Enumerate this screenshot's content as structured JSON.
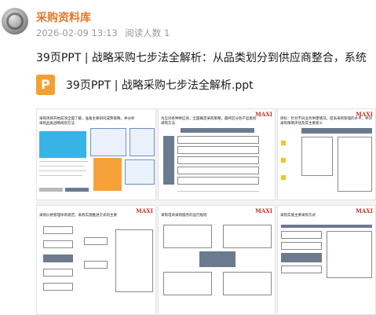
{
  "channel": {
    "name": "采购资料库",
    "date": "2026-02-09 13:13",
    "readers": "阅读人数 1"
  },
  "post": {
    "title": "39页PPT | 战略采购七步法全解析：从品类划分到供应商整合，系统",
    "file_icon_letter": "P",
    "file_name": "39页PPT | 战略采购七步法全解析.ppt"
  },
  "slides": {
    "s1": {
      "title_line1": "采购项目开始前须全面了解，准备主要研究成熟策略，并分析",
      "title_line2": "采购品类战略规划方法"
    },
    "s2": {
      "title_line1": "为应对各种供应商，全面确定采购策略，最终区分各产品类别",
      "title_line2": "采购方法"
    },
    "s3": {
      "title_line1": "目标：针对不同业务供需情况，提高采购管理的水平，并对",
      "title_line2": "采购策略评估及其主要意义"
    },
    "s4": {
      "title_line1": "采购价格管理体系规范，采购实施推进方式的主要",
      "title_line2": "供应商管理方式"
    },
    "s5": {
      "title_line1": "采购电商采购服务的运行规则"
    },
    "s6": {
      "title_line1": "采购实施主要采购方式"
    },
    "logo": "MAXI"
  }
}
